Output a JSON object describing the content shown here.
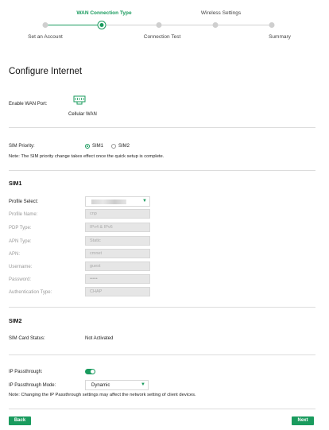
{
  "wizard": {
    "steps": [
      {
        "label": "Set an Account"
      },
      {
        "label": "WAN Connection Type"
      },
      {
        "label": "Connection Test"
      },
      {
        "label": "Wireless Settings"
      },
      {
        "label": "Summary"
      }
    ],
    "current_step": 2
  },
  "page": {
    "title": "Configure Internet"
  },
  "wan_port": {
    "label": "Enable WAN Port:",
    "option": "Cellular WAN",
    "icon": "cellular-port-icon"
  },
  "sim_priority": {
    "label": "SIM Priority:",
    "options": [
      "SIM1",
      "SIM2"
    ],
    "selected": "SIM1",
    "note": "Note: The SIM priority change takes effect once the quick setup is complete."
  },
  "sim1": {
    "title": "SIM1",
    "profile_select": {
      "label": "Profile Select:"
    },
    "fields": [
      {
        "label": "Profile Name:",
        "value": "cnp"
      },
      {
        "label": "PDP Type:",
        "value": "IPv4 & IPv6"
      },
      {
        "label": "APN Type:",
        "value": "Static"
      },
      {
        "label": "APN:",
        "value": "cmnet"
      },
      {
        "label": "Username:",
        "value": "guest"
      },
      {
        "label": "Password:",
        "value": "•••••"
      },
      {
        "label": "Authentication Type:",
        "value": "CHAP"
      }
    ]
  },
  "sim2": {
    "title": "SIM2",
    "card_status_label": "SIM Card Status:",
    "card_status_value": "Not Activated"
  },
  "ip_passthrough": {
    "label": "IP Passthrough:",
    "enabled": true,
    "mode_label": "IP Passthrough Mode:",
    "mode_value": "Dynamic",
    "note": "Note: Changing the IP Passthrough settings may affect the network setting of client devices."
  },
  "buttons": {
    "back": "Back",
    "next": "Next"
  },
  "colors": {
    "accent": "#1a9b5e",
    "field_bg": "#e6e6e6",
    "divider": "#dcdcdc"
  }
}
